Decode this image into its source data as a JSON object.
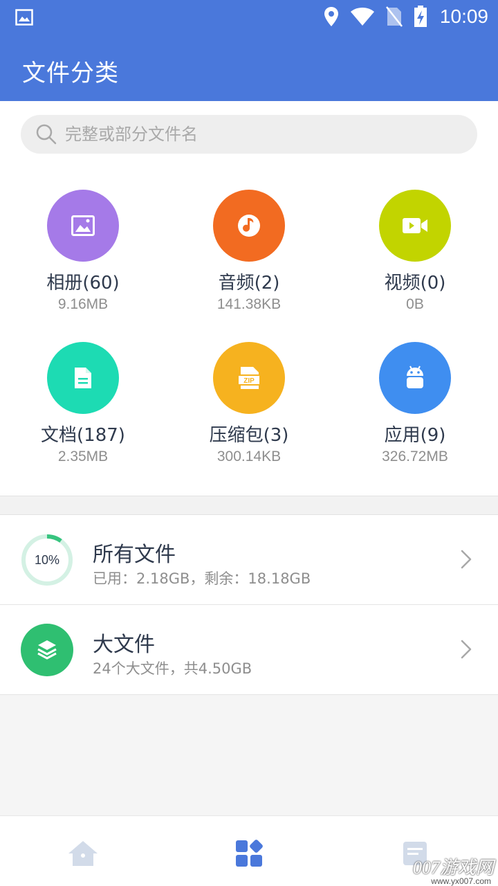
{
  "status_bar": {
    "time": "10:09",
    "icons": [
      "image-notification-icon",
      "location-icon",
      "wifi-icon",
      "no-sim-icon",
      "battery-charging-icon"
    ]
  },
  "header": {
    "title": "文件分类"
  },
  "search": {
    "placeholder": "完整或部分文件名",
    "value": ""
  },
  "categories": [
    {
      "label": "相册(60)",
      "size": "9.16MB",
      "icon": "image-icon",
      "color": "#a57ae8"
    },
    {
      "label": "音频(2)",
      "size": "141.38KB",
      "icon": "music-icon",
      "color": "#f26b21"
    },
    {
      "label": "视频(0)",
      "size": "0B",
      "icon": "video-icon",
      "color": "#c2d400"
    },
    {
      "label": "文档(187)",
      "size": "2.35MB",
      "icon": "document-icon",
      "color": "#1ddbb3"
    },
    {
      "label": "压缩包(3)",
      "size": "300.14KB",
      "icon": "zip-icon",
      "color": "#f6b21f"
    },
    {
      "label": "应用(9)",
      "size": "326.72MB",
      "icon": "android-icon",
      "color": "#3f8ef0"
    }
  ],
  "list": {
    "all_files": {
      "title": "所有文件",
      "subtitle": "已用：2.18GB，剩余：18.18GB",
      "percent_label": "10%",
      "used_fraction": 0.1,
      "ring_color": "#37c47f"
    },
    "large_files": {
      "title": "大文件",
      "subtitle": "24个大文件，共4.50GB",
      "icon": "layers-icon",
      "color": "#2fbf71"
    }
  },
  "bottom_nav": {
    "items": [
      "home-icon",
      "categories-icon",
      "recent-icon"
    ],
    "active_index": 1,
    "active_color": "#4a78db",
    "inactive_color": "#d2dbe9"
  },
  "watermark": {
    "text": "007游戏网",
    "sub": "www.yx007.com"
  }
}
